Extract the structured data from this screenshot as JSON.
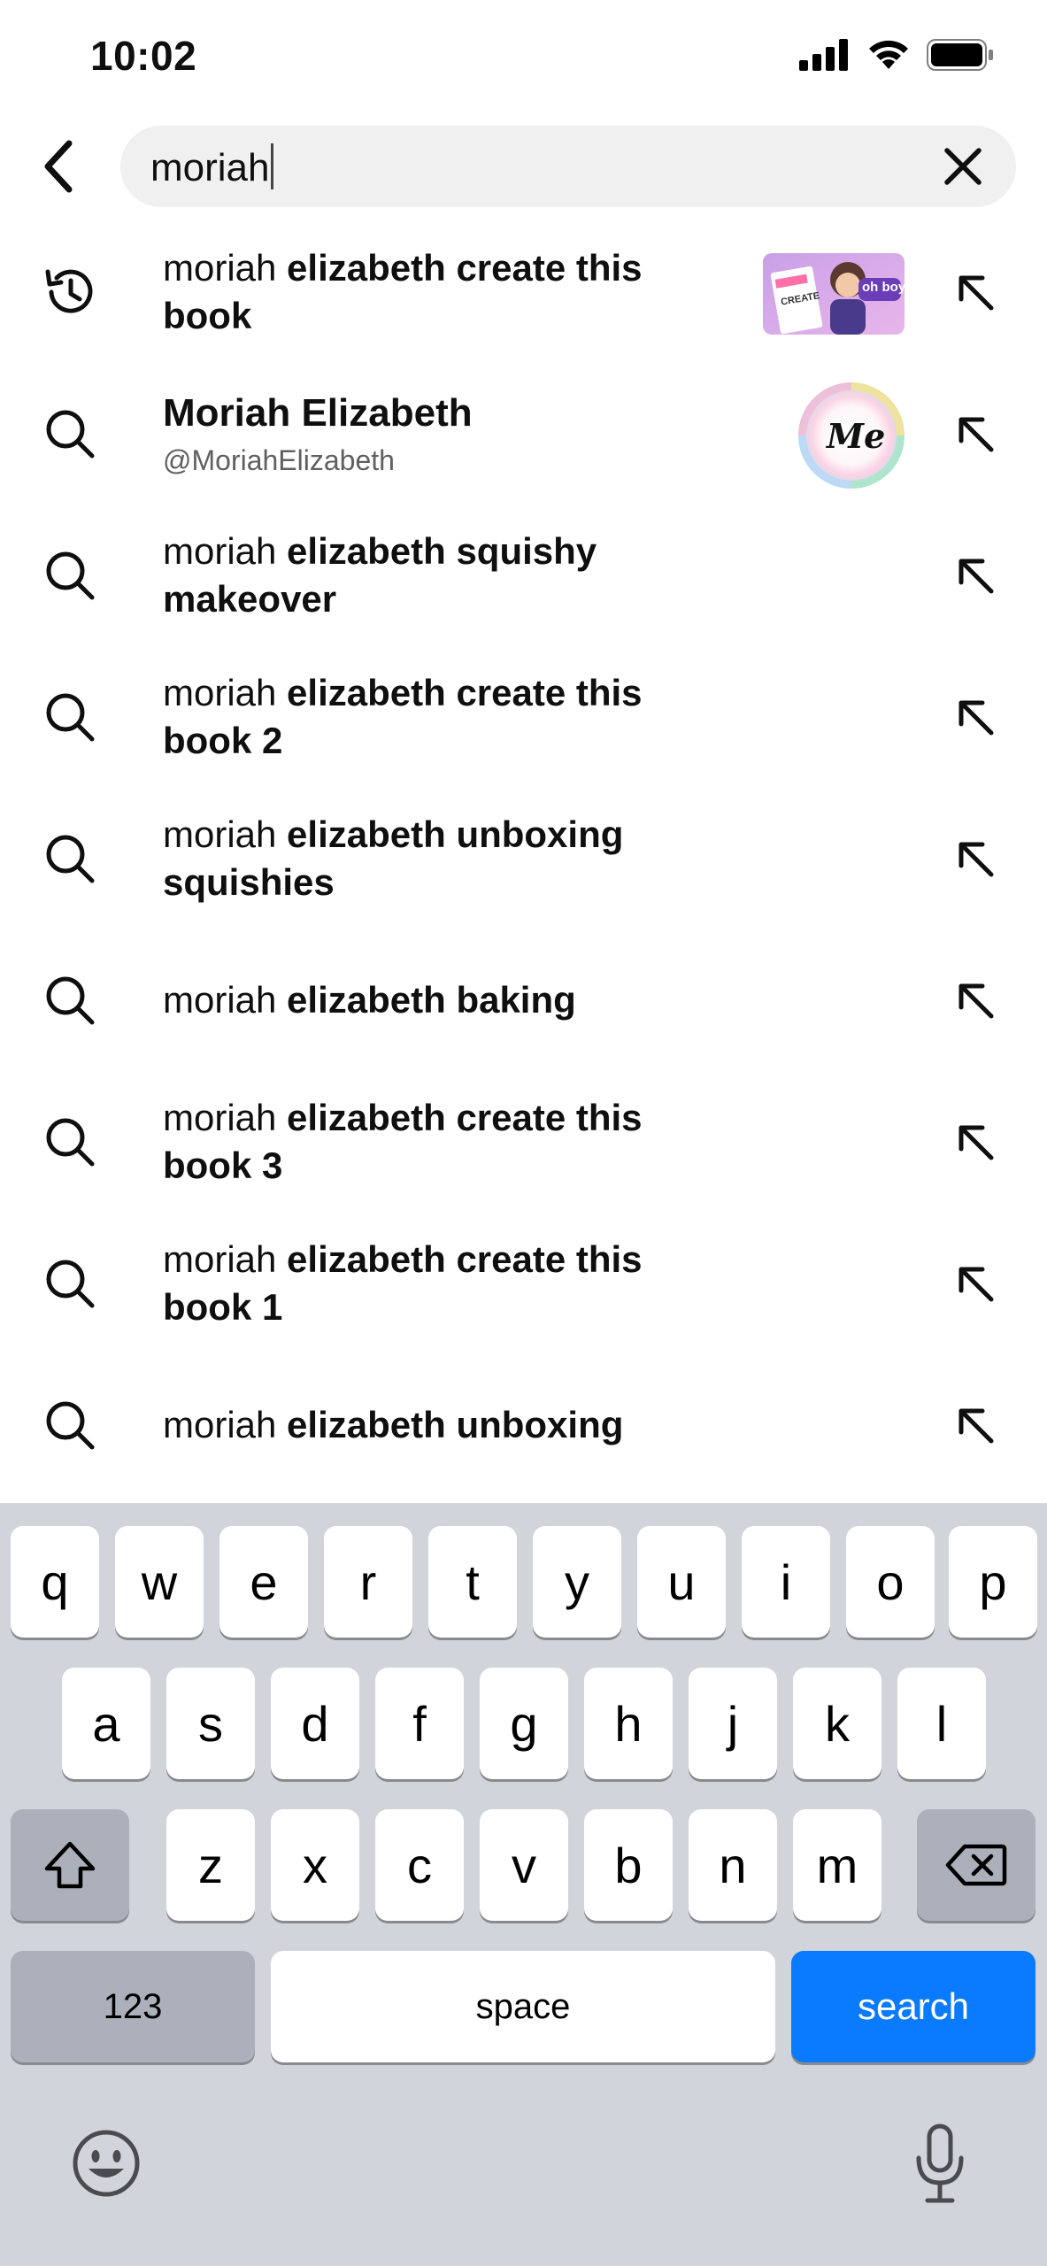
{
  "status_bar": {
    "time": "10:02"
  },
  "search": {
    "query": "moriah"
  },
  "suggestions": [
    {
      "type": "history",
      "prefix": "moriah",
      "rest": " elizabeth create this book"
    },
    {
      "type": "channel",
      "name": "Moriah Elizabeth",
      "handle": "@MoriahElizabeth"
    },
    {
      "type": "search",
      "prefix": "moriah",
      "rest": " elizabeth squishy makeover"
    },
    {
      "type": "search",
      "prefix": "moriah",
      "rest": " elizabeth create this book 2"
    },
    {
      "type": "search",
      "prefix": "moriah",
      "rest": " elizabeth unboxing squishies"
    },
    {
      "type": "search",
      "prefix": "moriah",
      "rest": " elizabeth baking"
    },
    {
      "type": "search",
      "prefix": "moriah",
      "rest": " elizabeth create this book 3"
    },
    {
      "type": "search",
      "prefix": "moriah",
      "rest": " elizabeth create this book 1"
    },
    {
      "type": "search",
      "prefix": "moriah",
      "rest": " elizabeth unboxing"
    }
  ],
  "thumbnail": {
    "caption": "oh boy.",
    "book_text": "CREATE"
  },
  "avatar": {
    "text": "Me"
  },
  "keyboard": {
    "row1": [
      "q",
      "w",
      "e",
      "r",
      "t",
      "y",
      "u",
      "i",
      "o",
      "p"
    ],
    "row2": [
      "a",
      "s",
      "d",
      "f",
      "g",
      "h",
      "j",
      "k",
      "l"
    ],
    "row3": [
      "z",
      "x",
      "c",
      "v",
      "b",
      "n",
      "m"
    ],
    "numbers_label": "123",
    "space_label": "space",
    "action_label": "search"
  },
  "colors": {
    "accent": "#0a7aff",
    "keyboard_bg": "#d1d4da",
    "search_bg": "#f0f0f0"
  }
}
